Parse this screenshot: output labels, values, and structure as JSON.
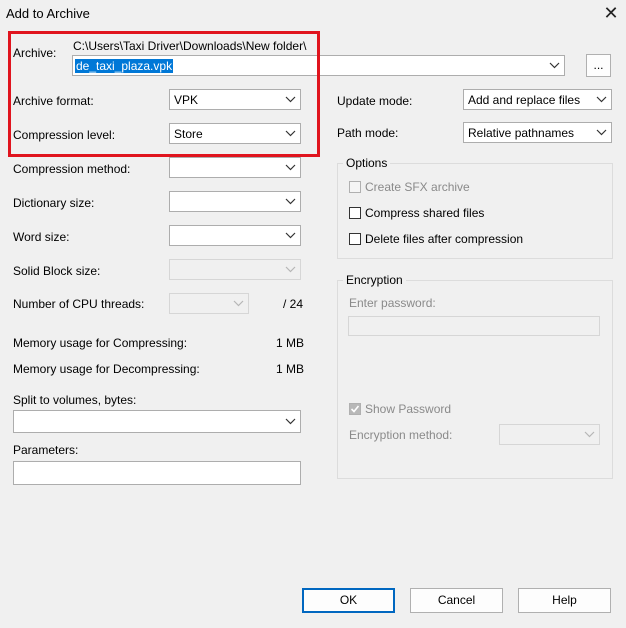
{
  "window": {
    "title": "Add to Archive",
    "close_glyph": "✕"
  },
  "archive": {
    "label": "Archive:",
    "path": "C:\\Users\\Taxi Driver\\Downloads\\New folder\\",
    "filename": "de_taxi_plaza.vpk",
    "browse_label": "..."
  },
  "left": {
    "archive_format_label": "Archive format:",
    "archive_format_value": "VPK",
    "compression_level_label": "Compression level:",
    "compression_level_value": "Store",
    "compression_method_label": "Compression method:",
    "compression_method_value": "",
    "dictionary_size_label": "Dictionary size:",
    "dictionary_size_value": "",
    "word_size_label": "Word size:",
    "word_size_value": "",
    "solid_block_label": "Solid Block size:",
    "solid_block_value": "",
    "cpu_threads_label": "Number of CPU threads:",
    "cpu_threads_value": "",
    "cpu_threads_total": "/ 24",
    "mem_compress_label": "Memory usage for Compressing:",
    "mem_compress_value": "1 MB",
    "mem_decompress_label": "Memory usage for Decompressing:",
    "mem_decompress_value": "1 MB",
    "split_label": "Split to volumes, bytes:",
    "split_value": "",
    "parameters_label": "Parameters:",
    "parameters_value": ""
  },
  "right": {
    "update_mode_label": "Update mode:",
    "update_mode_value": "Add and replace files",
    "path_mode_label": "Path mode:",
    "path_mode_value": "Relative pathnames",
    "options": {
      "legend": "Options",
      "create_sfx": {
        "label": "Create SFX archive",
        "checked": false,
        "enabled": false
      },
      "compress_shared": {
        "label": "Compress shared files",
        "checked": false,
        "enabled": true
      },
      "delete_after": {
        "label": "Delete files after compression",
        "checked": false,
        "enabled": true
      }
    },
    "encryption": {
      "legend": "Encryption",
      "password_label": "Enter password:",
      "password_value": "",
      "show_password": {
        "label": "Show Password",
        "checked": true,
        "enabled": false
      },
      "method_label": "Encryption method:",
      "method_value": ""
    }
  },
  "buttons": {
    "ok": "OK",
    "cancel": "Cancel",
    "help": "Help"
  },
  "colors": {
    "highlight_box": "#e0141e",
    "selection": "#0078d7",
    "default_button_border": "#0067c0"
  }
}
